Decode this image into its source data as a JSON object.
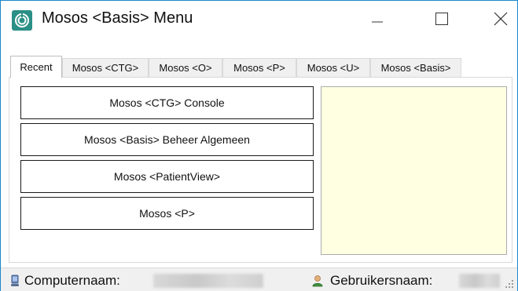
{
  "window": {
    "title": "Mosos <Basis> Menu",
    "accent_color": "#1a86c8",
    "icon_color": "#2a8f86"
  },
  "window_controls": {
    "minimize_icon": "minimize-icon",
    "maximize_icon": "maximize-icon",
    "close_icon": "close-icon"
  },
  "tabs": [
    {
      "label": "Recent",
      "active": true
    },
    {
      "label": "Mosos <CTG>",
      "active": false
    },
    {
      "label": "Mosos <O>",
      "active": false
    },
    {
      "label": "Mosos <P>",
      "active": false
    },
    {
      "label": "Mosos <U>",
      "active": false
    },
    {
      "label": "Mosos <Basis>",
      "active": false
    }
  ],
  "recent": {
    "buttons": [
      {
        "label": "Mosos <CTG> Console"
      },
      {
        "label": "Mosos <Basis> Beheer Algemeen"
      },
      {
        "label": "Mosos <PatientView>"
      },
      {
        "label": "Mosos <P>"
      }
    ],
    "preview_color": "#ffffe1"
  },
  "statusbar": {
    "computer_label": "Computernaam:",
    "user_label": "Gebruikersnaam:",
    "computer_icon": "computer-icon",
    "user_icon": "user-icon"
  }
}
